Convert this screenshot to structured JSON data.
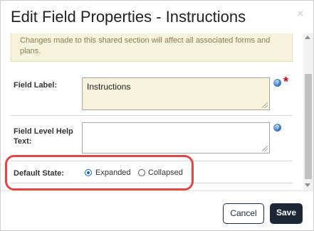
{
  "dialog": {
    "title": "Edit Field Properties - Instructions",
    "close_glyph": "×"
  },
  "notice": {
    "text": "Changes made to this shared section will affect all associated forms and plans."
  },
  "fields": {
    "field_label": {
      "label": "Field Label:",
      "value": "Instructions",
      "required_marker": "*"
    },
    "help_text": {
      "label": "Field Level Help Text:",
      "value": ""
    },
    "default_state": {
      "label": "Default State:",
      "options": [
        {
          "label": "Expanded",
          "checked": true
        },
        {
          "label": "Collapsed",
          "checked": false
        }
      ]
    }
  },
  "footer": {
    "cancel_label": "Cancel",
    "save_label": "Save"
  },
  "colors": {
    "accent": "#1565c0",
    "highlight": "#e04848",
    "primary_button": "#1c2738",
    "notice_bg": "#f7f3dc",
    "required": "#d0021b"
  },
  "icons": {
    "help": "globe-help-icon",
    "close": "close-icon"
  }
}
